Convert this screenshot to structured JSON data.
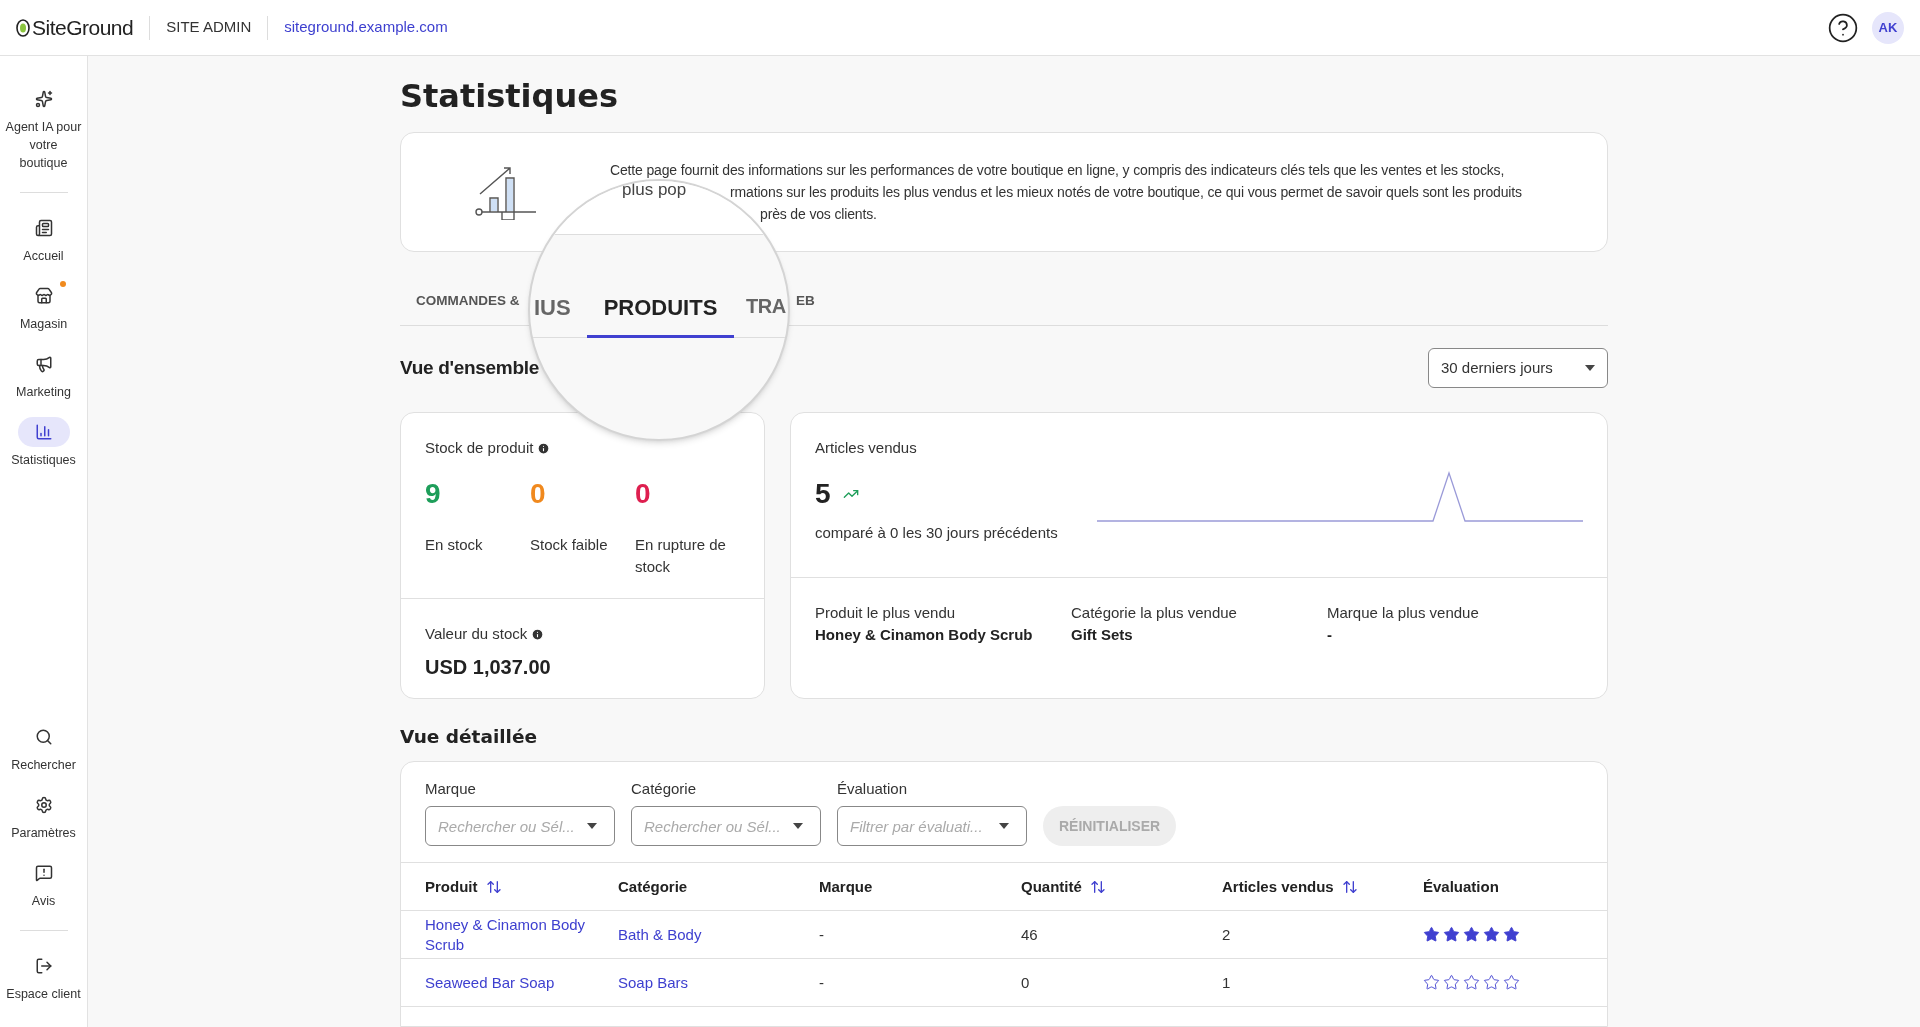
{
  "topbar": {
    "logo": "SiteGround",
    "section": "SITE ADMIN",
    "domain": "siteground.example.com",
    "avatar": "AK"
  },
  "sidebar": {
    "top_items": [
      {
        "kind": "sparkles",
        "label": "Agent IA pour votre boutique",
        "selected": false,
        "badge": false
      },
      {
        "kind": "home",
        "label": "Accueil",
        "selected": false,
        "badge": false
      },
      {
        "kind": "store",
        "label": "Magasin",
        "selected": false,
        "badge": true
      },
      {
        "kind": "megaphone",
        "label": "Marketing",
        "selected": false,
        "badge": false
      },
      {
        "kind": "chart",
        "label": "Statistiques",
        "selected": true,
        "badge": false
      }
    ],
    "bottom_items": [
      {
        "kind": "search",
        "label": "Rechercher",
        "selected": false,
        "badge": false
      },
      {
        "kind": "settings",
        "label": "Paramètres",
        "selected": false,
        "badge": false
      },
      {
        "kind": "feedback",
        "label": "Avis",
        "selected": false,
        "badge": false
      },
      {
        "kind": "exit",
        "label": "Espace client",
        "selected": false,
        "badge": false
      }
    ]
  },
  "page_title": "Statistiques",
  "intro_lines": [
    "Cette page fournit des informations sur les performances de votre boutique en ligne, y compris des indicateurs clés tels que les ventes et les stocks,",
    "rmations sur les produits les plus vendus et les mieux notés de votre boutique, ce qui vous permet de savoir quels sont les produits",
    "près de vos clients."
  ],
  "tabs": [
    {
      "label": "COMMANDES &",
      "selected": false
    },
    {
      "label": "EB",
      "selected": false
    }
  ],
  "magnifier": {
    "top_text": "plus pop",
    "tabs": [
      {
        "label": "IUS",
        "selected": false
      },
      {
        "label": "PRODUITS",
        "selected": true
      },
      {
        "label": "TRA",
        "selected": false
      }
    ]
  },
  "overview": {
    "heading": "Vue d'ensemble",
    "period": "30 derniers jours",
    "stock": {
      "title": "Stock de produit",
      "counts": [
        {
          "value": "9",
          "label": "En stock",
          "color": "#1e9e5a"
        },
        {
          "value": "0",
          "label": "Stock faible",
          "color": "#f0891e"
        },
        {
          "value": "0",
          "label": "En rupture de stock",
          "color": "#de1f4f"
        }
      ],
      "value_label": "Valeur du stock",
      "value": "USD 1,037.00"
    },
    "sales": {
      "title": "Articles vendus",
      "value": "5",
      "comparison": "comparé à 0 les 30 jours précédents",
      "best": [
        {
          "label": "Produit le plus vendu",
          "value": "Honey & Cinamon Body Scrub"
        },
        {
          "label": "Catégorie la plus vendue",
          "value": "Gift Sets"
        },
        {
          "label": "Marque la plus vendue",
          "value": "-"
        }
      ]
    }
  },
  "detail": {
    "heading": "Vue détaillée",
    "filters": [
      {
        "label": "Marque",
        "placeholder": "Rechercher ou Sél..."
      },
      {
        "label": "Catégorie",
        "placeholder": "Rechercher ou Sél..."
      },
      {
        "label": "Évaluation",
        "placeholder": "Filtrer par évaluati..."
      }
    ],
    "reset": {
      "label": "RÉINITIALISER",
      "disabled": true
    },
    "columns": [
      {
        "label": "Produit",
        "sortable": true
      },
      {
        "label": "Catégorie",
        "sortable": false
      },
      {
        "label": "Marque",
        "sortable": false
      },
      {
        "label": "Quantité",
        "sortable": true
      },
      {
        "label": "Articles vendus",
        "sortable": true
      },
      {
        "label": "Évaluation",
        "sortable": false
      }
    ],
    "rows": [
      {
        "product": "Honey & Cinamon Body Scrub",
        "category": "Bath & Body",
        "brand": "-",
        "quantity": "46",
        "sold": "2",
        "stars": 5
      },
      {
        "product": "Seaweed Bar Soap",
        "category": "Soap Bars",
        "brand": "-",
        "quantity": "0",
        "sold": "1",
        "stars": 0
      }
    ]
  }
}
